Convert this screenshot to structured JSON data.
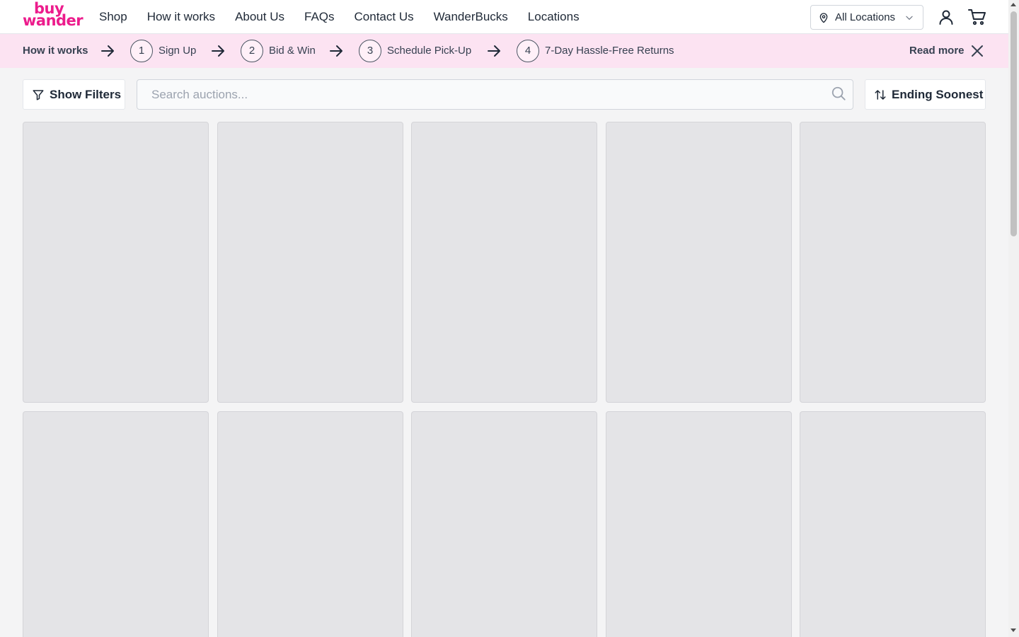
{
  "brand": {
    "line1": "buy",
    "line2": "wander",
    "color": "#ec1c8c"
  },
  "nav": {
    "links": [
      "Shop",
      "How it works",
      "About Us",
      "FAQs",
      "Contact Us",
      "WanderBucks",
      "Locations"
    ],
    "location_select": "All Locations",
    "icons": [
      "map-pin-icon",
      "chevron-down-icon",
      "user-icon",
      "cart-icon"
    ]
  },
  "banner": {
    "title": "How it works",
    "steps": [
      {
        "num": "1",
        "label": "Sign Up"
      },
      {
        "num": "2",
        "label": "Bid & Win"
      },
      {
        "num": "3",
        "label": "Schedule Pick-Up"
      },
      {
        "num": "4",
        "label": "7-Day Hassle-Free Returns"
      }
    ],
    "read_more": "Read more",
    "background": "#fce3f2"
  },
  "toolbar": {
    "filters_label": "Show Filters",
    "search_placeholder": "Search auctions...",
    "sort_label": "Ending Soonest"
  },
  "grid": {
    "placeholder_count": 10,
    "placeholder_color": "#e4e4e7"
  }
}
